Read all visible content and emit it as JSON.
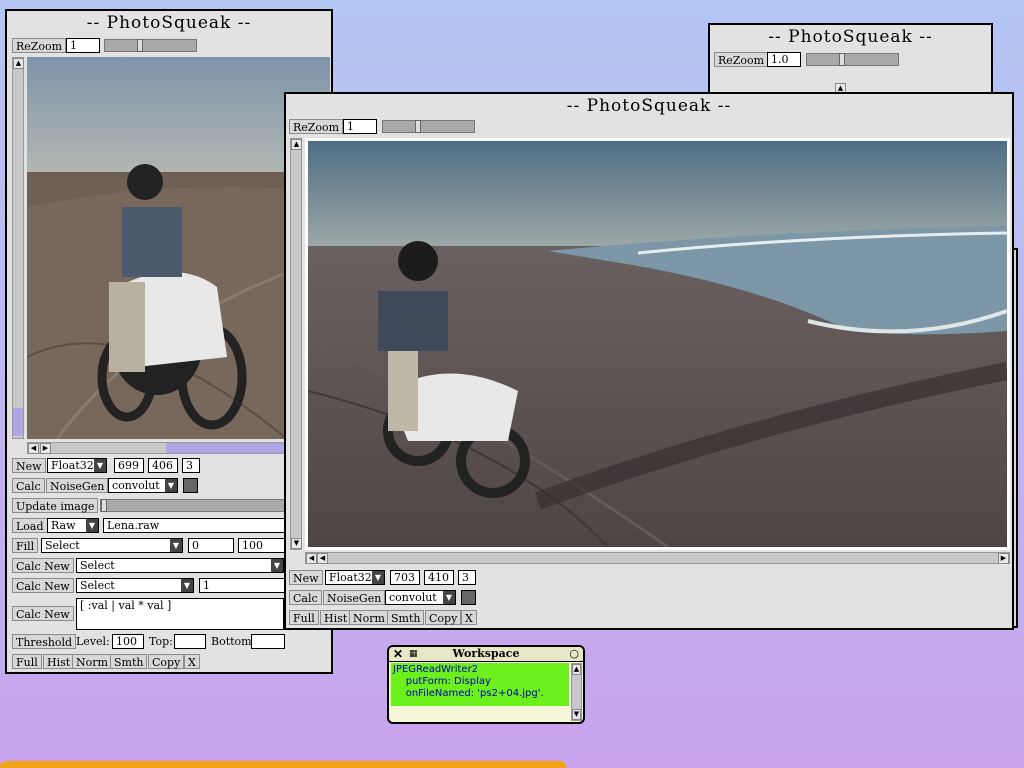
{
  "windows": {
    "left": {
      "title": "-- PhotoSqueak --",
      "rezoom_label": "ReZoom",
      "zoom_value": "1",
      "zoom_level": 0.38,
      "row_new": {
        "label": "New",
        "type": "Float32",
        "width": "699",
        "height": "406",
        "channels": "3"
      },
      "row_calc": {
        "label": "Calc",
        "noise_label": "NoiseGen",
        "filter": "convolut"
      },
      "update_label": "Update image",
      "row_load": {
        "label": "Load",
        "format": "Raw",
        "filename": "Lena.raw"
      },
      "row_fill": {
        "label": "Fill",
        "select": "Select",
        "from": "0",
        "to": "100"
      },
      "calcnew1": {
        "label": "Calc New",
        "select": "Select"
      },
      "calcnew2": {
        "label": "Calc New",
        "select": "Select",
        "value": "1"
      },
      "calcnew3": {
        "label": "Calc New",
        "code": "[ :val | val * val ]"
      },
      "threshold": {
        "label": "Threshold",
        "level_label": "Level:",
        "level": "100",
        "top_label": "Top:",
        "top": "",
        "bottom_label": "Bottom:",
        "bottom": ""
      },
      "actions": [
        "Full",
        "Hist",
        "Norm",
        "Smth",
        "Copy",
        "X"
      ]
    },
    "back": {
      "title": "-- PhotoSqueak --",
      "rezoom_label": "ReZoom",
      "zoom_value": "1.0",
      "zoom_level": 0.38
    },
    "front": {
      "title": "-- PhotoSqueak --",
      "rezoom_label": "ReZoom",
      "zoom_value": "1",
      "zoom_level": 0.38,
      "row_new": {
        "label": "New",
        "type": "Float32",
        "width": "703",
        "height": "410",
        "channels": "3"
      },
      "row_calc": {
        "label": "Calc",
        "noise_label": "NoiseGen",
        "filter": "convolut"
      },
      "actions": [
        "Full",
        "Hist",
        "Norm",
        "Smth",
        "Copy",
        "X"
      ]
    }
  },
  "workspace": {
    "title": "Workspace",
    "lines": [
      "JPEGReadWriter2",
      "    putForm: Display",
      "    onFileNamed: 'ps2+04.jpg'."
    ]
  },
  "colors": {
    "workspace_text_bg": "#6cf01c",
    "window_bg": "#e2e2e2",
    "taskbar": "#f4a418"
  }
}
